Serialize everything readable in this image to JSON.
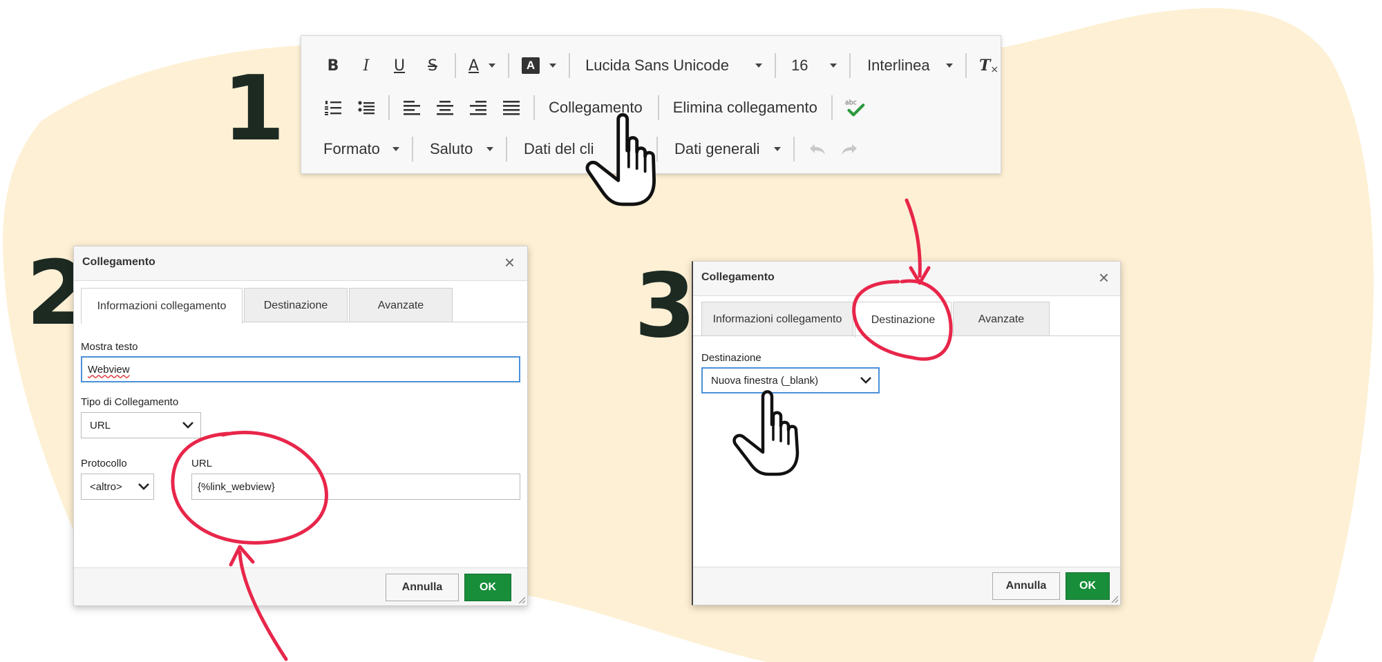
{
  "background": {
    "page_color": "#ffffff",
    "blob_color": "#fef0d4"
  },
  "steps": [
    "1",
    "2",
    "3"
  ],
  "annotation_color": "#e8264a",
  "toolbar": {
    "row1": {
      "bold": "B",
      "italic": "I",
      "underline": "U",
      "strike": "S",
      "text_color": "A",
      "bg_color": "A",
      "font": "Lucida Sans Unicode",
      "size": "16",
      "line_height": "Interlinea",
      "clear_format": "T"
    },
    "row2": {
      "icons": [
        "numbered-list-icon",
        "bullet-list-icon",
        "align-left-icon",
        "align-center-icon",
        "align-right-icon",
        "align-justify-icon"
      ],
      "link": "Collegamento",
      "unlink": "Elimina collegamento",
      "spellcheck_icon": "spellcheck-icon"
    },
    "row3": {
      "format": "Formato",
      "greeting": "Saluto",
      "client_data": "Dati del cli",
      "general_data": "Dati generali",
      "undo_icon": "undo-icon",
      "redo_icon": "redo-icon"
    }
  },
  "dialog1": {
    "title": "Collegamento",
    "close": "×",
    "tabs": [
      "Informazioni collegamento",
      "Destinazione",
      "Avanzate"
    ],
    "active_tab": 0,
    "display_text_label": "Mostra testo",
    "display_text_value": "Webview",
    "link_type_label": "Tipo di Collegamento",
    "link_type_value": "URL",
    "protocol_label": "Protocollo",
    "protocol_value": "<altro>",
    "url_label": "URL",
    "url_value": "{%link_webview}",
    "cancel": "Annulla",
    "ok": "OK"
  },
  "dialog2": {
    "title": "Collegamento",
    "close": "×",
    "tabs": [
      "Informazioni collegamento",
      "Destinazione",
      "Avanzate"
    ],
    "active_tab": 1,
    "target_label": "Destinazione",
    "target_value": "Nuova finestra (_blank)",
    "cancel": "Annulla",
    "ok": "OK"
  }
}
